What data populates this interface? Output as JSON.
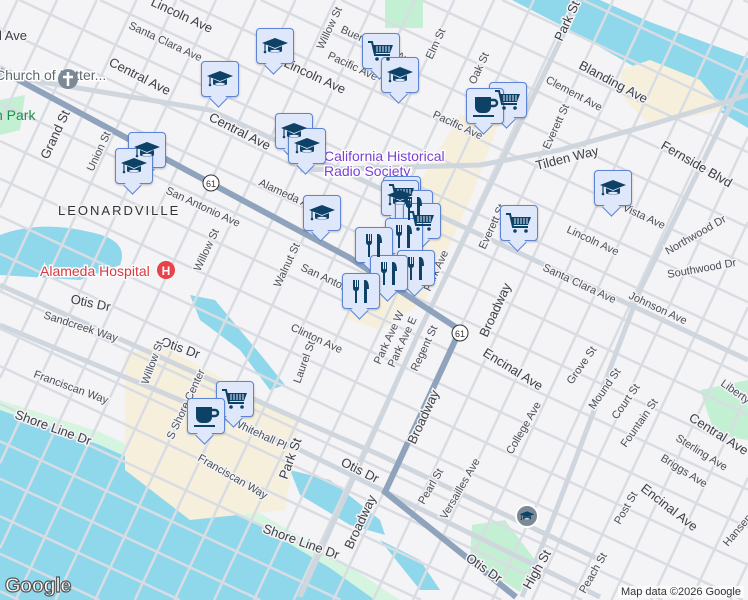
{
  "map": {
    "neighborhood": "LEONARDVILLE",
    "pois": {
      "church": "Church of Latter...",
      "park": "n Park",
      "hospital": "Alameda Hospital",
      "radio_line1": "California Historical",
      "radio_line2": "Radio Society"
    },
    "highway_shield": "61",
    "streets": [
      "Lincoln Ave",
      "Central Ave",
      "Santa Clara Ave",
      "Central Ave",
      "Central Ave",
      "Lincoln Ave",
      "Willow St",
      "Buena Vista Ave",
      "Pacific Ave",
      "Elm St",
      "Oak St",
      "Pacific Ave",
      "Park St",
      "Blanding Ave",
      "Clement Ave",
      "Everett St",
      "Tilden Way",
      "Fernside Blvd",
      "Vista Ave",
      "Lincoln Ave",
      "Northwood Dr",
      "Southwood Dr",
      "Santa Clara Ave",
      "Johnson Ave",
      "Everett St",
      "Park Ave",
      "Grand St",
      "Union St",
      "San Antonio Ave",
      "Willow St",
      "Alameda Ave",
      "Walnut St",
      "San Antonio Ave",
      "Otis Dr",
      "Sandcreek Way",
      "Otis Dr",
      "Clinton Ave",
      "Laurel St",
      "Willow St",
      "Franciscan Way",
      "S Shore Center",
      "Whitehall Pl",
      "Park St",
      "Franciscan Way",
      "Shore Line Dr",
      "Shore Line Dr",
      "Otis Dr",
      "Broadway",
      "Broadway",
      "Broadway",
      "Park Ave W",
      "Park Ave E",
      "Regent St",
      "Encinal Ave",
      "Grove St",
      "Mound St",
      "Court St",
      "Fountain St",
      "College Ave",
      "Versailles Ave",
      "Pearl St",
      "Central Ave",
      "Sterling Ave",
      "Briggs Ave",
      "Encinal Ave",
      "Post St",
      "High St",
      "Peach St",
      "Otis Dr",
      "Liberty Ave",
      "Hansen Ave",
      "Park",
      "Fernside Blvd"
    ],
    "markers": [
      "school",
      "school",
      "school",
      "school",
      "school",
      "school",
      "school",
      "school",
      "shopping-cart",
      "school",
      "coffee",
      "shopping-cart",
      "shopping-cart",
      "school",
      "coffee",
      "shopping-cart",
      "shopping-cart",
      "restaurant",
      "shopping-cart",
      "restaurant",
      "restaurant",
      "restaurant",
      "restaurant",
      "restaurant"
    ],
    "google_logo": "Google",
    "attribution": "Map data ©2026 Google"
  },
  "colors": {
    "water": "#8fd8ec",
    "park": "#c3efd2",
    "shopping": "#f6efdc",
    "highway": "#8fa3bd",
    "marker_bg": "#dfe8fb",
    "marker_border": "#5b83d6",
    "marker_icon": "#0d4166"
  }
}
